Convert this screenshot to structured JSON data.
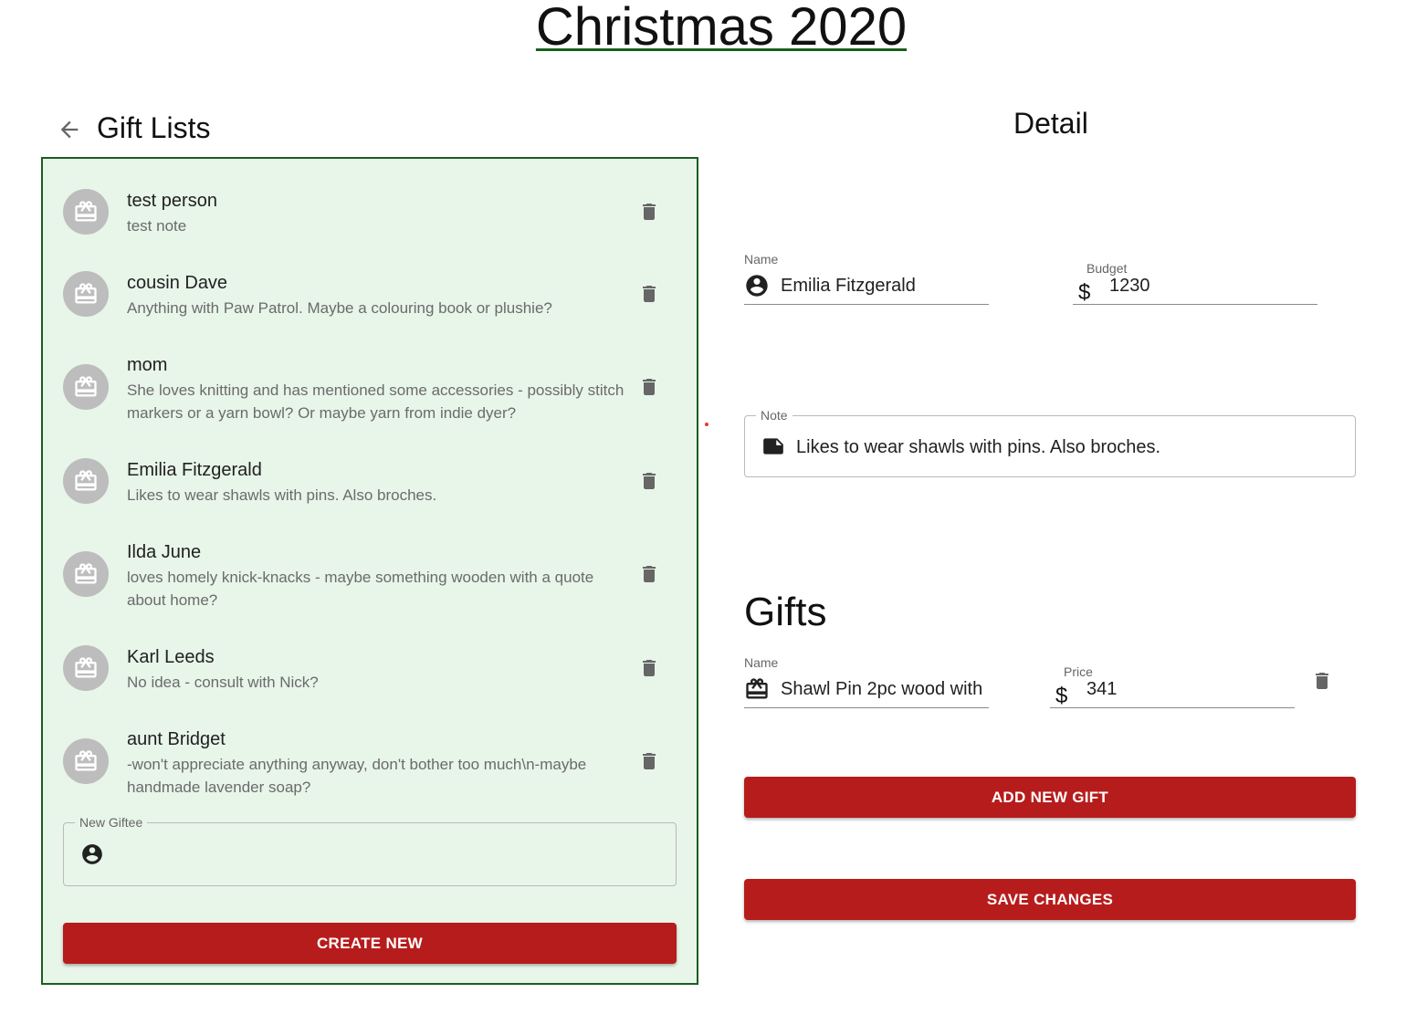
{
  "page": {
    "title": "Christmas 2020"
  },
  "list_panel": {
    "title": "Gift Lists",
    "items": [
      {
        "name": "test person",
        "note": "test note"
      },
      {
        "name": "cousin Dave",
        "note": "Anything with Paw Patrol. Maybe a colouring book or plushie?"
      },
      {
        "name": "mom",
        "note": "She loves knitting and has mentioned some accessories - possibly stitch markers or a yarn bowl? Or maybe yarn from indie dyer?"
      },
      {
        "name": "Emilia Fitzgerald",
        "note": "Likes to wear shawls with pins. Also broches."
      },
      {
        "name": "Ilda June",
        "note": "loves homely knick-knacks - maybe something wooden with a quote about home?"
      },
      {
        "name": "Karl Leeds",
        "note": "No idea - consult with Nick?"
      },
      {
        "name": "aunt Bridget",
        "note": "-won't appreciate anything anyway, don't bother too much\\n-maybe handmade lavender soap?"
      }
    ],
    "new_giftee": {
      "label": "New Giftee",
      "value": ""
    },
    "create_button": "CREATE NEW"
  },
  "detail": {
    "title": "Detail",
    "name_label": "Name",
    "name_value": "Emilia Fitzgerald",
    "budget_label": "Budget",
    "currency_symbol": "$",
    "budget_value": "1230",
    "note_label": "Note",
    "note_value": "Likes to wear shawls with pins. Also broches.",
    "gifts_title": "Gifts",
    "gift": {
      "name_label": "Name",
      "name_value": "Shawl Pin 2pc wood with",
      "price_label": "Price",
      "price_value": "341"
    },
    "add_gift_button": "ADD NEW GIFT",
    "save_button": "SAVE CHANGES"
  },
  "colors": {
    "accent_red": "#b71c1c",
    "panel_green_bg": "#e8f5e9",
    "panel_green_border": "#1b5e20"
  },
  "icons": {
    "back": "arrow-left-icon",
    "avatar": "gift-card-icon",
    "delete": "trash-icon",
    "person": "account-circle-icon",
    "note": "note-icon"
  }
}
